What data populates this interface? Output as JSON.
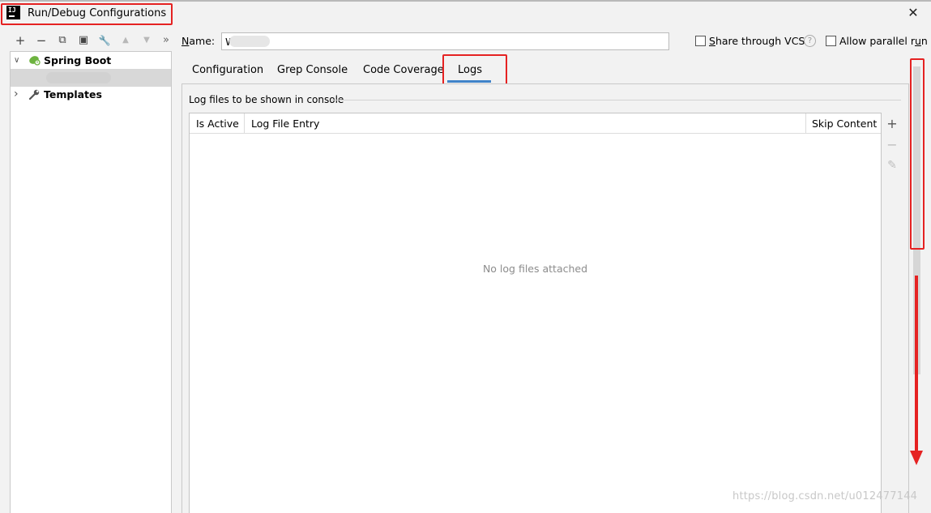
{
  "window": {
    "title": "Run/Debug Configurations",
    "app_icon_text": "IJ",
    "close_glyph": "✕"
  },
  "toolbar": {
    "icons": [
      "add-icon",
      "remove-icon",
      "copy-icon",
      "save-icon",
      "wrench-icon",
      "move-up-icon",
      "move-down-icon",
      "more-icon"
    ],
    "glyphs": {
      "add": "+",
      "remove": "−",
      "copy": "⧉",
      "save": "▣",
      "wrench": "🔧",
      "up": "▲",
      "down": "▼",
      "more": "»"
    }
  },
  "tree": {
    "items": [
      {
        "label": "Spring Boot",
        "expanded": true,
        "icon": "spring-boot-icon",
        "arrow": "∨"
      },
      {
        "label": "Templates",
        "expanded": false,
        "icon": "wrench-icon",
        "arrow": "›"
      }
    ]
  },
  "name_field": {
    "label_prefix": "",
    "label_mnemonic": "N",
    "label_rest": "ame:",
    "value": "W      PI"
  },
  "options": {
    "share_label_mnemonic": "S",
    "share_label_rest": "hare through VCS",
    "share_checked": false,
    "help_glyph": "?",
    "parallel_label_mnemonic_pre": "Allow parallel r",
    "parallel_label_mnemonic": "u",
    "parallel_label_rest": "n",
    "parallel_checked": false
  },
  "tabs": [
    {
      "label": "Configuration",
      "active": false
    },
    {
      "label": "Grep Console",
      "active": false
    },
    {
      "label": "Code Coverage",
      "active": false
    },
    {
      "label": "Logs",
      "active": true
    }
  ],
  "logs": {
    "group_title": "Log files to be shown in console",
    "columns": [
      "Is Active",
      "Log File Entry",
      "Skip Content"
    ],
    "rows": [],
    "empty_text": "No log files attached",
    "side_buttons": {
      "add": "+",
      "remove": "−",
      "edit": "✎"
    }
  },
  "annotation_colors": {
    "red": "#e52222",
    "tab_underline": "#4083c9"
  },
  "watermark": "https://blog.csdn.net/u012477144"
}
